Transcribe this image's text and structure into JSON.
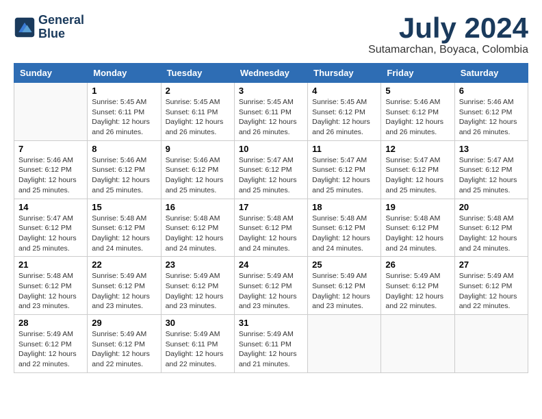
{
  "header": {
    "logo_line1": "General",
    "logo_line2": "Blue",
    "month_year": "July 2024",
    "location": "Sutamarchan, Boyaca, Colombia"
  },
  "weekdays": [
    "Sunday",
    "Monday",
    "Tuesday",
    "Wednesday",
    "Thursday",
    "Friday",
    "Saturday"
  ],
  "weeks": [
    [
      {
        "day": "",
        "detail": ""
      },
      {
        "day": "1",
        "detail": "Sunrise: 5:45 AM\nSunset: 6:11 PM\nDaylight: 12 hours\nand 26 minutes."
      },
      {
        "day": "2",
        "detail": "Sunrise: 5:45 AM\nSunset: 6:11 PM\nDaylight: 12 hours\nand 26 minutes."
      },
      {
        "day": "3",
        "detail": "Sunrise: 5:45 AM\nSunset: 6:11 PM\nDaylight: 12 hours\nand 26 minutes."
      },
      {
        "day": "4",
        "detail": "Sunrise: 5:45 AM\nSunset: 6:12 PM\nDaylight: 12 hours\nand 26 minutes."
      },
      {
        "day": "5",
        "detail": "Sunrise: 5:46 AM\nSunset: 6:12 PM\nDaylight: 12 hours\nand 26 minutes."
      },
      {
        "day": "6",
        "detail": "Sunrise: 5:46 AM\nSunset: 6:12 PM\nDaylight: 12 hours\nand 26 minutes."
      }
    ],
    [
      {
        "day": "7",
        "detail": "Sunrise: 5:46 AM\nSunset: 6:12 PM\nDaylight: 12 hours\nand 25 minutes."
      },
      {
        "day": "8",
        "detail": "Sunrise: 5:46 AM\nSunset: 6:12 PM\nDaylight: 12 hours\nand 25 minutes."
      },
      {
        "day": "9",
        "detail": "Sunrise: 5:46 AM\nSunset: 6:12 PM\nDaylight: 12 hours\nand 25 minutes."
      },
      {
        "day": "10",
        "detail": "Sunrise: 5:47 AM\nSunset: 6:12 PM\nDaylight: 12 hours\nand 25 minutes."
      },
      {
        "day": "11",
        "detail": "Sunrise: 5:47 AM\nSunset: 6:12 PM\nDaylight: 12 hours\nand 25 minutes."
      },
      {
        "day": "12",
        "detail": "Sunrise: 5:47 AM\nSunset: 6:12 PM\nDaylight: 12 hours\nand 25 minutes."
      },
      {
        "day": "13",
        "detail": "Sunrise: 5:47 AM\nSunset: 6:12 PM\nDaylight: 12 hours\nand 25 minutes."
      }
    ],
    [
      {
        "day": "14",
        "detail": "Sunrise: 5:47 AM\nSunset: 6:12 PM\nDaylight: 12 hours\nand 25 minutes."
      },
      {
        "day": "15",
        "detail": "Sunrise: 5:48 AM\nSunset: 6:12 PM\nDaylight: 12 hours\nand 24 minutes."
      },
      {
        "day": "16",
        "detail": "Sunrise: 5:48 AM\nSunset: 6:12 PM\nDaylight: 12 hours\nand 24 minutes."
      },
      {
        "day": "17",
        "detail": "Sunrise: 5:48 AM\nSunset: 6:12 PM\nDaylight: 12 hours\nand 24 minutes."
      },
      {
        "day": "18",
        "detail": "Sunrise: 5:48 AM\nSunset: 6:12 PM\nDaylight: 12 hours\nand 24 minutes."
      },
      {
        "day": "19",
        "detail": "Sunrise: 5:48 AM\nSunset: 6:12 PM\nDaylight: 12 hours\nand 24 minutes."
      },
      {
        "day": "20",
        "detail": "Sunrise: 5:48 AM\nSunset: 6:12 PM\nDaylight: 12 hours\nand 24 minutes."
      }
    ],
    [
      {
        "day": "21",
        "detail": "Sunrise: 5:48 AM\nSunset: 6:12 PM\nDaylight: 12 hours\nand 23 minutes."
      },
      {
        "day": "22",
        "detail": "Sunrise: 5:49 AM\nSunset: 6:12 PM\nDaylight: 12 hours\nand 23 minutes."
      },
      {
        "day": "23",
        "detail": "Sunrise: 5:49 AM\nSunset: 6:12 PM\nDaylight: 12 hours\nand 23 minutes."
      },
      {
        "day": "24",
        "detail": "Sunrise: 5:49 AM\nSunset: 6:12 PM\nDaylight: 12 hours\nand 23 minutes."
      },
      {
        "day": "25",
        "detail": "Sunrise: 5:49 AM\nSunset: 6:12 PM\nDaylight: 12 hours\nand 23 minutes."
      },
      {
        "day": "26",
        "detail": "Sunrise: 5:49 AM\nSunset: 6:12 PM\nDaylight: 12 hours\nand 22 minutes."
      },
      {
        "day": "27",
        "detail": "Sunrise: 5:49 AM\nSunset: 6:12 PM\nDaylight: 12 hours\nand 22 minutes."
      }
    ],
    [
      {
        "day": "28",
        "detail": "Sunrise: 5:49 AM\nSunset: 6:12 PM\nDaylight: 12 hours\nand 22 minutes."
      },
      {
        "day": "29",
        "detail": "Sunrise: 5:49 AM\nSunset: 6:12 PM\nDaylight: 12 hours\nand 22 minutes."
      },
      {
        "day": "30",
        "detail": "Sunrise: 5:49 AM\nSunset: 6:11 PM\nDaylight: 12 hours\nand 22 minutes."
      },
      {
        "day": "31",
        "detail": "Sunrise: 5:49 AM\nSunset: 6:11 PM\nDaylight: 12 hours\nand 21 minutes."
      },
      {
        "day": "",
        "detail": ""
      },
      {
        "day": "",
        "detail": ""
      },
      {
        "day": "",
        "detail": ""
      }
    ]
  ]
}
